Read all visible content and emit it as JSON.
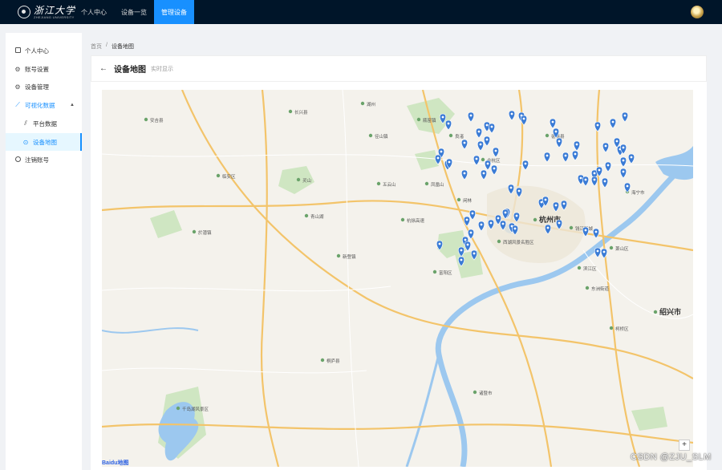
{
  "topbar": {
    "logo_text": "浙江大学",
    "logo_subtext": "ZHEJIANG UNIVERSITY",
    "nav": [
      {
        "label": "个人中心"
      },
      {
        "label": "设备一览"
      },
      {
        "label": "管理设备"
      }
    ],
    "active_nav": 2
  },
  "sidebar": {
    "items": [
      {
        "label": "个人中心",
        "icon": "user-box-icon"
      },
      {
        "label": "账号设置",
        "icon": "gear-icon"
      },
      {
        "label": "设备管理",
        "icon": "gear-icon"
      },
      {
        "label": "可视化数据",
        "icon": "chart-icon",
        "expanded": true
      },
      {
        "label": "平台数据",
        "icon": "chart-icon"
      },
      {
        "label": "设备地图",
        "icon": "location-icon",
        "selected": true
      },
      {
        "label": "注销账号",
        "icon": "logout-icon"
      }
    ]
  },
  "breadcrumb": {
    "home": "首页",
    "separator": "/",
    "current": "设备地图"
  },
  "header": {
    "title": "设备地图",
    "subtitle": "实时显示"
  },
  "map": {
    "logo": "Baidu地图",
    "zoom_in": "+",
    "labels": [
      "杭州市",
      "绍兴市",
      "西湖风景名胜区",
      "桐庐县",
      "富阳区",
      "杭徐高速",
      "临安区",
      "萧山区",
      "新登镇",
      "千岛湖风景区",
      "余杭区",
      "滨江区",
      "柯桥区",
      "诸暨市",
      "安吉县",
      "德清县",
      "海宁市",
      "东洲街道",
      "钱江新城",
      "长兴县",
      "湖州",
      "良渚",
      "瓶窑镇",
      "径山镇",
      "闲林",
      "灵山",
      "五云山",
      "凤凰山",
      "青山湖",
      "於潜镇"
    ],
    "marker_color": "#3a7bd5"
  },
  "watermark": "CSDN @ZJU_SLM"
}
